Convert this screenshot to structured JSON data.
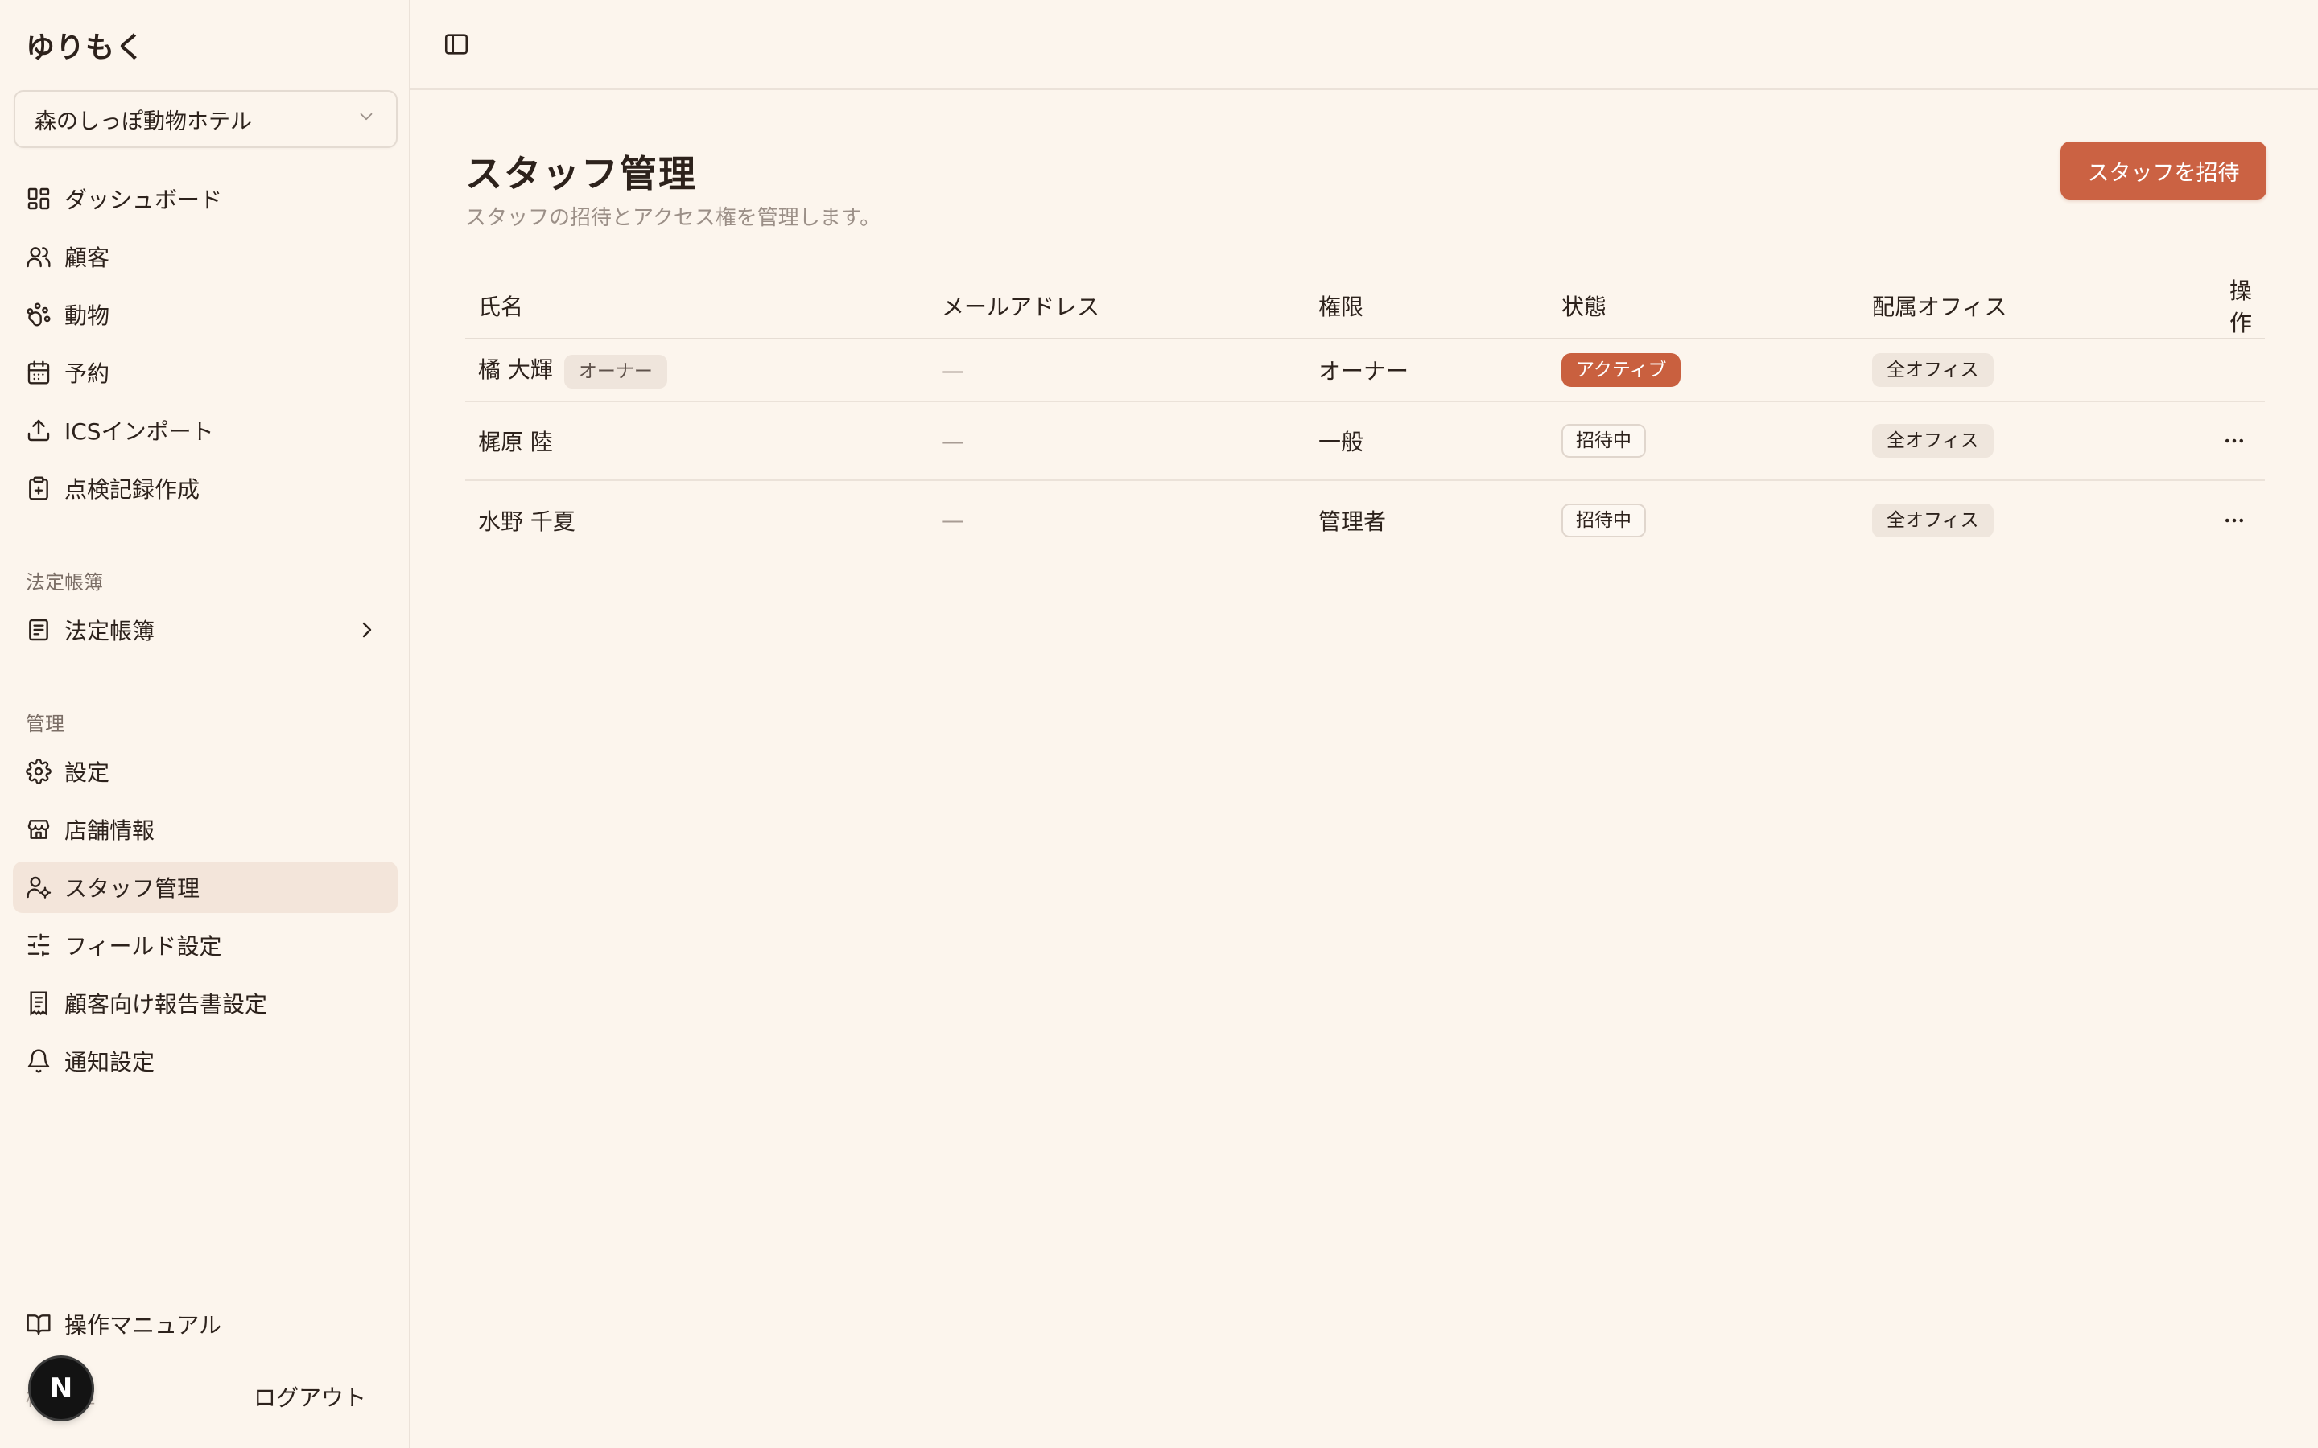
{
  "sidebar": {
    "brand": "ゆりもく",
    "store_select": "森のしっぽ動物ホテル",
    "nav_main": [
      {
        "label": "ダッシュボード",
        "icon": "dashboard-icon"
      },
      {
        "label": "顧客",
        "icon": "users-icon"
      },
      {
        "label": "動物",
        "icon": "paw-icon"
      },
      {
        "label": "予約",
        "icon": "calendar-icon"
      },
      {
        "label": "ICSインポート",
        "icon": "upload-icon"
      },
      {
        "label": "点検記録作成",
        "icon": "clipboard-plus-icon"
      }
    ],
    "section_ledger": "法定帳簿",
    "nav_ledger": [
      {
        "label": "法定帳簿",
        "icon": "book-icon"
      }
    ],
    "section_admin": "管理",
    "nav_admin": [
      {
        "label": "設定",
        "icon": "gear-icon"
      },
      {
        "label": "店舗情報",
        "icon": "store-icon"
      },
      {
        "label": "スタッフ管理",
        "icon": "user-cog-icon",
        "active": true
      },
      {
        "label": "フィールド設定",
        "icon": "sliders-icon"
      },
      {
        "label": "顧客向け報告書設定",
        "icon": "receipt-icon"
      },
      {
        "label": "通知設定",
        "icon": "bell-icon"
      }
    ],
    "manual": "操作マニュアル",
    "avatar_letter": "N",
    "footer_user": "橘 大輝",
    "logout": "ログアウト"
  },
  "main": {
    "title": "スタッフ管理",
    "subtitle": "スタッフの招待とアクセス権を管理します。",
    "invite_button": "スタッフを招待",
    "table": {
      "headers": [
        "氏名",
        "メールアドレス",
        "権限",
        "状態",
        "配属オフィス",
        "操作"
      ],
      "rows": [
        {
          "name": "橘 大輝",
          "tag": "オーナー",
          "email": "—",
          "role": "オーナー",
          "status": "アクティブ",
          "office": "全オフィス"
        },
        {
          "name": "梶原 陸",
          "email": "—",
          "role": "一般",
          "status": "招待中",
          "office": "全オフィス"
        },
        {
          "name": "水野 千夏",
          "email": "—",
          "role": "管理者",
          "status": "招待中",
          "office": "全オフィス"
        }
      ]
    }
  },
  "colors": {
    "background": "#fcf5ed",
    "accent": "#cb6243",
    "active_nav": "#f3e5da"
  }
}
